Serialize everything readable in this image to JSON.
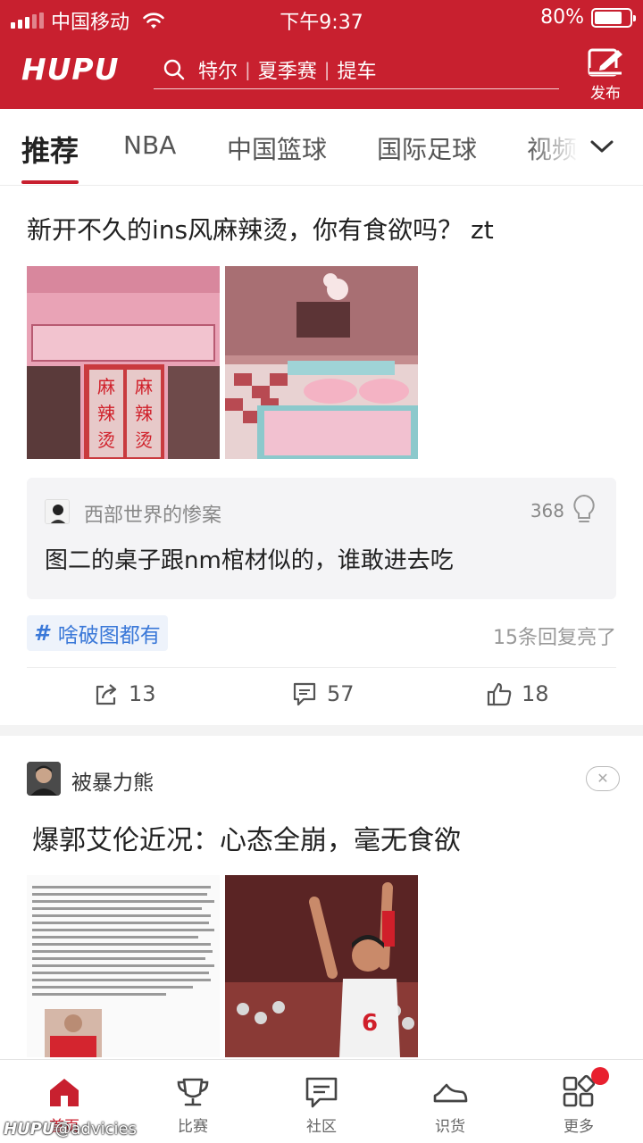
{
  "status_bar": {
    "carrier": "中国移动",
    "time": "下午9:37",
    "battery": "80%",
    "battery_level": 0.8
  },
  "header": {
    "logo": "HUPU",
    "search_hot_words": [
      "特尔",
      "夏季赛",
      "提车"
    ],
    "publish_label": "发布"
  },
  "tabs": [
    {
      "label": "推荐",
      "active": true
    },
    {
      "label": "NBA"
    },
    {
      "label": "中国篮球"
    },
    {
      "label": "国际足球"
    },
    {
      "label": "视频"
    }
  ],
  "post1": {
    "title": "新开不久的ins风麻辣烫，你有食欲吗？ zt",
    "images": [
      "storefront-photo",
      "interior-photo"
    ],
    "comment": {
      "user": "西部世界的惨案",
      "likes": "368",
      "text": "图二的桌子跟nm棺材似的，谁敢进去吃"
    },
    "topic_tag": "啥破图都有",
    "reply_lit": "15条回复亮了",
    "actions": {
      "share": "13",
      "comments": "57",
      "likes": "18"
    }
  },
  "post2": {
    "author": "被暴力熊",
    "title": "爆郭艾伦近况：心态全崩，毫无食欲",
    "images": [
      "article-screenshot",
      "basketball-player-photo"
    ],
    "close_symbol": "✕"
  },
  "bottom_nav": [
    {
      "label": "首页",
      "icon": "home-icon",
      "active": true
    },
    {
      "label": "比赛",
      "icon": "trophy-icon"
    },
    {
      "label": "社区",
      "icon": "chat-icon"
    },
    {
      "label": "识货",
      "icon": "sneaker-icon"
    },
    {
      "label": "更多",
      "icon": "grid-icon",
      "badge": true
    }
  ],
  "watermark": {
    "brand": "HUPU",
    "handle": "@advicies"
  },
  "colors": {
    "brand_red": "#c8202f",
    "link_blue": "#3a78d8"
  }
}
